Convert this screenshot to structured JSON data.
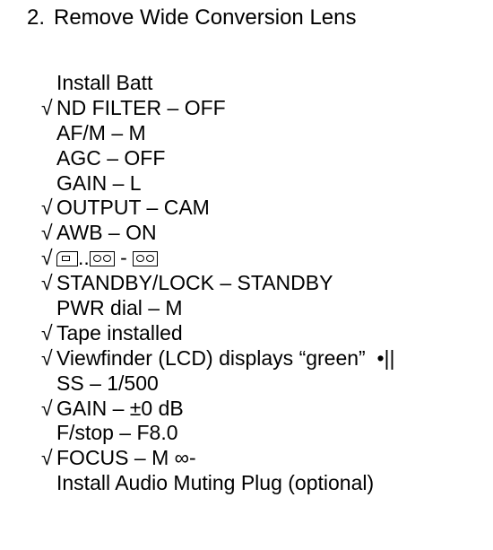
{
  "heading": {
    "number": "2.",
    "text": "Remove Wide Conversion Lens"
  },
  "check_mark": "√",
  "items": [
    {
      "checked": false,
      "text": "Install Batt"
    },
    {
      "checked": true,
      "text": "ND FILTER – OFF"
    },
    {
      "checked": false,
      "text": "AF/M – M"
    },
    {
      "checked": false,
      "text": "AGC – OFF"
    },
    {
      "checked": false,
      "text": "GAIN – L"
    },
    {
      "checked": true,
      "text": "OUTPUT – CAM"
    },
    {
      "checked": true,
      "text": "AWB – ON"
    },
    {
      "checked": true,
      "text": "",
      "icons": {
        "card": "memory-card-icon",
        "dots": "..",
        "tape": "tape-cassette-icon",
        "dash": " - "
      }
    },
    {
      "checked": true,
      "text": "STANDBY/LOCK – STANDBY"
    },
    {
      "checked": false,
      "text": "PWR dial – M"
    },
    {
      "checked": true,
      "text": "Tape installed"
    },
    {
      "checked": true,
      "text": "Viewfinder (LCD) displays “green”  •||"
    },
    {
      "checked": false,
      "text": "SS – 1/500"
    },
    {
      "checked": true,
      "text": "GAIN – ±0 dB"
    },
    {
      "checked": false,
      "text": "F/stop – F8.0"
    },
    {
      "checked": true,
      "text": "FOCUS – M ∞-"
    },
    {
      "checked": false,
      "text": "Install Audio Muting Plug (optional)"
    }
  ]
}
